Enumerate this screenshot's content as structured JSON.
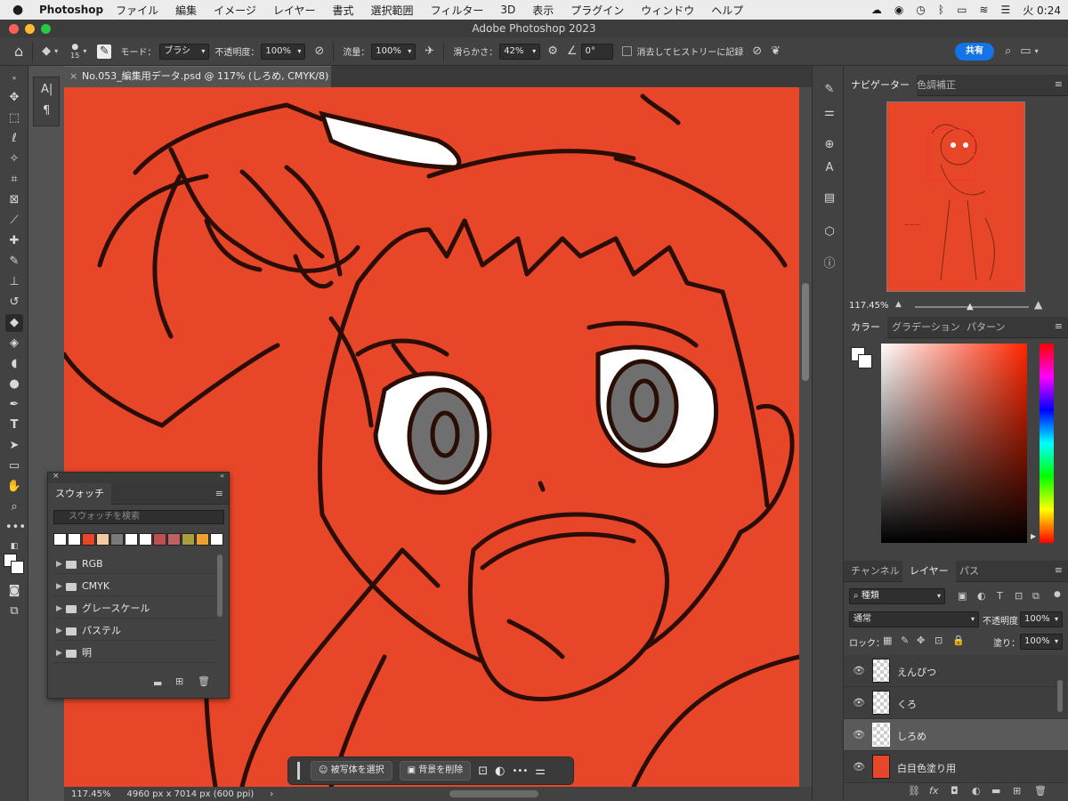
{
  "menubar": {
    "app_name": "Photoshop",
    "items": [
      "ファイル",
      "編集",
      "イメージ",
      "レイヤー",
      "書式",
      "選択範囲",
      "フィルター",
      "3D",
      "表示",
      "プラグイン",
      "ウィンドウ",
      "ヘルプ"
    ],
    "clock": "火 0:24"
  },
  "window": {
    "title": "Adobe Photoshop 2023"
  },
  "options_bar": {
    "brush_size": "15",
    "mode_label": "モード：",
    "mode_value": "ブラシ",
    "opacity_label": "不透明度：",
    "opacity_value": "100%",
    "flow_label": "流量：",
    "flow_value": "100%",
    "smoothing_label": "滑らかさ：",
    "smoothing_value": "42%",
    "angle_value": "0°",
    "history_label": "消去してヒストリーに記録",
    "share_label": "共有"
  },
  "document": {
    "tab_title": "No.053_編集用データ.psd @ 117% (しろめ, CMYK/8) *",
    "canvas_color": "#e84628"
  },
  "status_bar": {
    "zoom": "117.45%",
    "dimensions": "4960 px x 7014 px (600 ppi)"
  },
  "context_bar": {
    "select_subject": "被写体を選択",
    "remove_background": "背景を削除",
    "more": "•••"
  },
  "swatches_panel": {
    "tab": "スウォッチ",
    "search_placeholder": "スウォッチを検索",
    "colors": [
      "#ffffff",
      "#ffffff",
      "#e84628",
      "#f5c9a0",
      "#7a7a7a",
      "#ffffff",
      "#ffffff",
      "#c05050",
      "#c06060",
      "#a8a040",
      "#f0a030",
      "#ffffff"
    ],
    "folders": [
      "RGB",
      "CMYK",
      "グレースケール",
      "パステル",
      "明"
    ]
  },
  "navigator_panel": {
    "tabs": [
      "ナビゲーター",
      "色調補正"
    ],
    "zoom": "117.45%"
  },
  "color_panel": {
    "tabs": [
      "カラー",
      "グラデーション",
      "パターン"
    ]
  },
  "layers_panel": {
    "tabs": [
      "チャンネル",
      "レイヤー",
      "パス"
    ],
    "filter_label": "種類",
    "blend_mode": "通常",
    "opacity_label": "不透明度：",
    "opacity_value": "100%",
    "lock_label": "ロック：",
    "fill_label": "塗り：",
    "fill_value": "100%",
    "layers": [
      {
        "name": "えんぴつ",
        "thumb": "checker"
      },
      {
        "name": "くろ",
        "thumb": "checker"
      },
      {
        "name": "しろめ",
        "thumb": "checker",
        "selected": true
      },
      {
        "name": "白目色塗り用",
        "thumb": "#e84628"
      }
    ]
  }
}
